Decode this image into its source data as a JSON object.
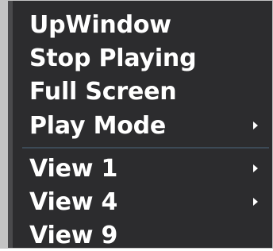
{
  "context_menu": {
    "items": [
      {
        "label": "UpWindow",
        "has_submenu": false
      },
      {
        "label": "Stop Playing",
        "has_submenu": false
      },
      {
        "label": "Full Screen",
        "has_submenu": false
      },
      {
        "label": "Play Mode",
        "has_submenu": true
      },
      {
        "label": "View 1",
        "has_submenu": true
      },
      {
        "label": "View 4",
        "has_submenu": true
      },
      {
        "label": "View 9",
        "has_submenu": false
      }
    ]
  }
}
